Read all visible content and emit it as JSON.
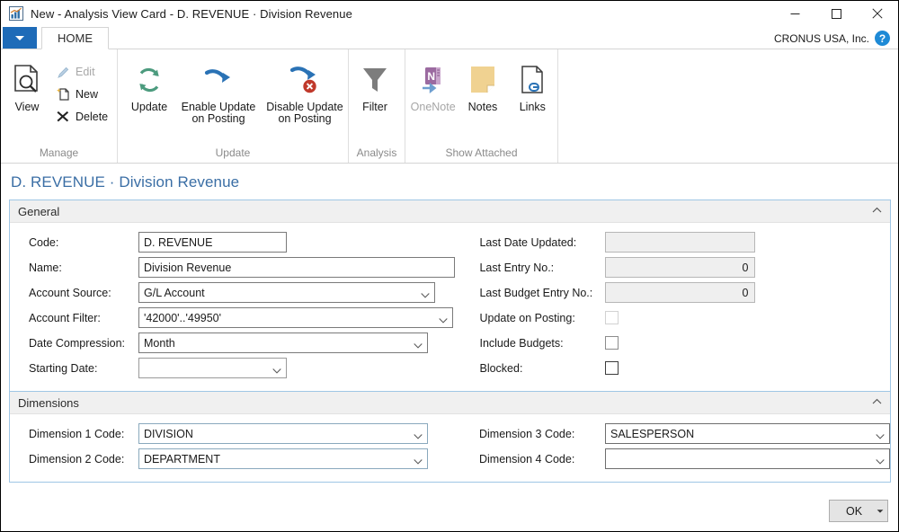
{
  "window": {
    "title": "New - Analysis View Card - D. REVENUE · Division Revenue",
    "app_icon": "chart-icon",
    "minimize_label": "—",
    "maximize_label": "▢",
    "close_label": "✕"
  },
  "ribbon": {
    "app_menu_label": "",
    "tab_home_label": "HOME",
    "company": "CRONUS USA, Inc.",
    "help_label": "?",
    "groups": [
      {
        "title": "Manage",
        "big": [
          {
            "label": "View",
            "icon": "view-page-magnifier-icon",
            "enabled": true
          }
        ],
        "small": [
          {
            "label": "Edit",
            "icon": "pencil-icon",
            "enabled": false
          },
          {
            "label": "New",
            "icon": "new-page-icon",
            "enabled": true
          },
          {
            "label": "Delete",
            "icon": "delete-x-icon",
            "enabled": true
          }
        ]
      },
      {
        "title": "Update",
        "big": [
          {
            "label": "Update",
            "icon": "refresh-circular-arrows-icon",
            "enabled": true
          },
          {
            "label": "Enable Update\non Posting",
            "label_line1": "Enable Update",
            "label_line2": "on Posting",
            "icon": "blue-arrow-right-icon",
            "enabled": true
          },
          {
            "label": "Disable Update\non Posting",
            "label_line1": "Disable Update",
            "label_line2": "on Posting",
            "icon": "blue-arrow-error-icon",
            "enabled": true
          }
        ],
        "small": []
      },
      {
        "title": "Analysis",
        "big": [
          {
            "label": "Filter",
            "icon": "funnel-filter-icon",
            "enabled": true
          }
        ],
        "small": []
      },
      {
        "title": "Show Attached",
        "big": [
          {
            "label": "OneNote",
            "icon": "onenote-icon",
            "enabled": false
          },
          {
            "label": "Notes",
            "icon": "sticky-note-icon",
            "enabled": true
          },
          {
            "label": "Links",
            "icon": "link-page-icon",
            "enabled": true
          }
        ],
        "small": []
      }
    ]
  },
  "page": {
    "title": "D. REVENUE · Division Revenue",
    "general": {
      "header": "General",
      "collapse_glyph": "⌃",
      "left_fields": [
        {
          "label": "Code:",
          "value": "D. REVENUE",
          "type": "text"
        },
        {
          "label": "Name:",
          "value": "Division Revenue",
          "type": "text"
        },
        {
          "label": "Account Source:",
          "value": "G/L Account",
          "type": "dropdown"
        },
        {
          "label": "Account Filter:",
          "value": "'42000'..'49950'",
          "type": "dropdown"
        },
        {
          "label": "Date Compression:",
          "value": "Month",
          "type": "dropdown"
        },
        {
          "label": "Starting Date:",
          "value": "",
          "type": "dropdown"
        }
      ],
      "right_fields": [
        {
          "label": "Last Date Updated:",
          "value": "",
          "type": "readonly"
        },
        {
          "label": "Last Entry No.:",
          "value": "0",
          "type": "readonly"
        },
        {
          "label": "Last Budget Entry No.:",
          "value": "0",
          "type": "readonly"
        },
        {
          "label": "Update on Posting:",
          "value": "",
          "type": "checkbox",
          "checked": false,
          "enabled": false
        },
        {
          "label": "Include Budgets:",
          "value": "",
          "type": "checkbox",
          "checked": false,
          "enabled": true
        },
        {
          "label": "Blocked:",
          "value": "",
          "type": "checkbox",
          "checked": false,
          "enabled": true
        }
      ]
    },
    "dimensions": {
      "header": "Dimensions",
      "collapse_glyph": "⌃",
      "left_fields": [
        {
          "label": "Dimension 1 Code:",
          "value": "DIVISION",
          "type": "dropdown"
        },
        {
          "label": "Dimension 2 Code:",
          "value": "DEPARTMENT",
          "type": "dropdown"
        }
      ],
      "right_fields": [
        {
          "label": "Dimension 3 Code:",
          "value": "SALESPERSON",
          "type": "dropdown"
        },
        {
          "label": "Dimension 4 Code:",
          "value": "",
          "type": "dropdown"
        }
      ]
    },
    "footer": {
      "ok_label": "OK",
      "ok_split_glyph": "▾"
    }
  },
  "colors": {
    "accent_blue": "#1e6bb8",
    "title_link_blue": "#3a6ea5",
    "group_border_blue": "#9fc6e5",
    "update_green": "#4c9b7e",
    "arrow_blue": "#2a72b5",
    "error_red": "#c0392b",
    "notes_yellow": "#f0d291",
    "onenote_purple": "#9b6aa0",
    "filter_gray": "#7a7a7a"
  }
}
